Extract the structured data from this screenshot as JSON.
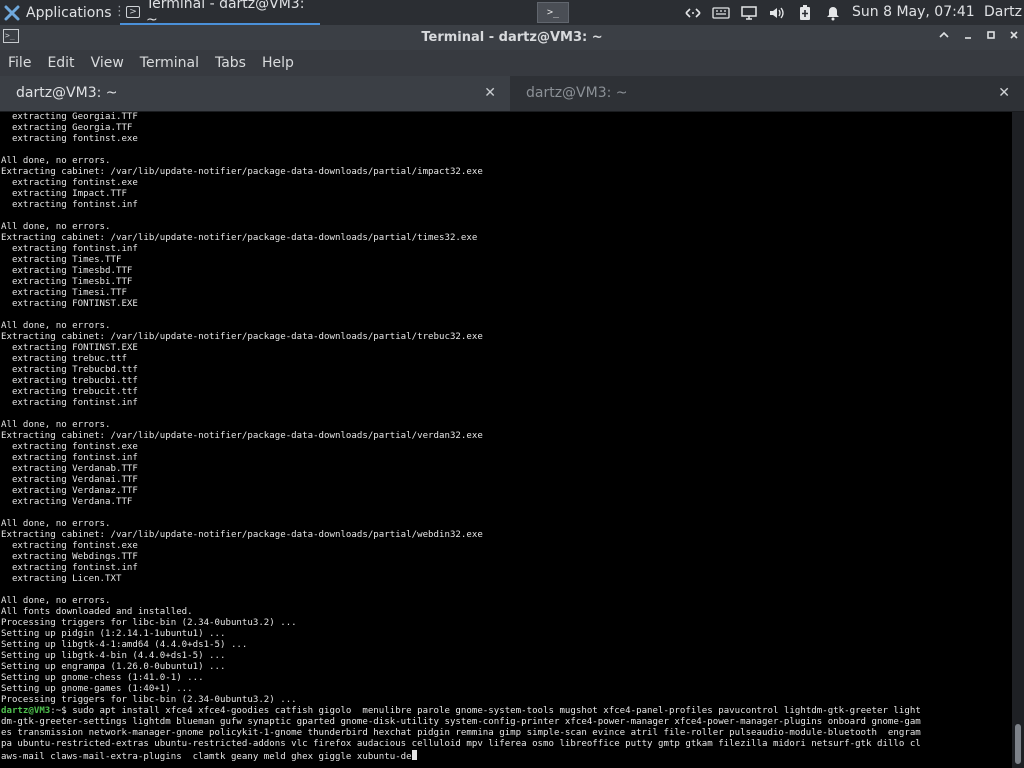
{
  "panel": {
    "applications_label": "Applications",
    "task_title": "Terminal - dartz@VM3: ~",
    "launcher_icon": ">_",
    "clock": "Sun  8 May, 07:41",
    "user": "Dartz",
    "tray_icons": [
      "network-icon",
      "keyboard-icon",
      "display-icon",
      "volume-icon",
      "battery-icon",
      "notification-bell-icon"
    ],
    "accent_color": "#4a90d9"
  },
  "window": {
    "title": "Terminal - dartz@VM3: ~",
    "buttons": {
      "maximize_up": "^",
      "minimize": "_",
      "restore": "□",
      "close": "×"
    }
  },
  "menu": [
    "File",
    "Edit",
    "View",
    "Terminal",
    "Tabs",
    "Help"
  ],
  "tabs": [
    {
      "label": "dartz@VM3: ~",
      "active": true
    },
    {
      "label": "dartz@VM3: ~",
      "active": false
    }
  ],
  "terminal": {
    "lines": [
      "  extracting Georgiai.TTF",
      "  extracting Georgia.TTF",
      "  extracting fontinst.exe",
      "",
      "All done, no errors.",
      "Extracting cabinet: /var/lib/update-notifier/package-data-downloads/partial/impact32.exe",
      "  extracting fontinst.exe",
      "  extracting Impact.TTF",
      "  extracting fontinst.inf",
      "",
      "All done, no errors.",
      "Extracting cabinet: /var/lib/update-notifier/package-data-downloads/partial/times32.exe",
      "  extracting fontinst.inf",
      "  extracting Times.TTF",
      "  extracting Timesbd.TTF",
      "  extracting Timesbi.TTF",
      "  extracting Timesi.TTF",
      "  extracting FONTINST.EXE",
      "",
      "All done, no errors.",
      "Extracting cabinet: /var/lib/update-notifier/package-data-downloads/partial/trebuc32.exe",
      "  extracting FONTINST.EXE",
      "  extracting trebuc.ttf",
      "  extracting Trebucbd.ttf",
      "  extracting trebucbi.ttf",
      "  extracting trebucit.ttf",
      "  extracting fontinst.inf",
      "",
      "All done, no errors.",
      "Extracting cabinet: /var/lib/update-notifier/package-data-downloads/partial/verdan32.exe",
      "  extracting fontinst.exe",
      "  extracting fontinst.inf",
      "  extracting Verdanab.TTF",
      "  extracting Verdanai.TTF",
      "  extracting Verdanaz.TTF",
      "  extracting Verdana.TTF",
      "",
      "All done, no errors.",
      "Extracting cabinet: /var/lib/update-notifier/package-data-downloads/partial/webdin32.exe",
      "  extracting fontinst.exe",
      "  extracting Webdings.TTF",
      "  extracting fontinst.inf",
      "  extracting Licen.TXT",
      "",
      "All done, no errors.",
      "All fonts downloaded and installed.",
      "Processing triggers for libc-bin (2.34-0ubuntu3.2) ...",
      "Setting up pidgin (1:2.14.1-1ubuntu1) ...",
      "Setting up libgtk-4-1:amd64 (4.4.0+ds1-5) ...",
      "Setting up libgtk-4-bin (4.4.0+ds1-5) ...",
      "Setting up engrampa (1.26.0-0ubuntu1) ...",
      "Setting up gnome-chess (1:41.0-1) ...",
      "Setting up gnome-games (1:40+1) ...",
      "Processing triggers for libc-bin (2.34-0ubuntu3.2) ..."
    ],
    "prompt_user": "dartz@VM3",
    "prompt_suffix": ":~$ ",
    "command_lines": [
      "sudo apt install xfce4 xfce4-goodies catfish gigolo  menulibre parole gnome-system-tools mugshot xfce4-panel-profiles pavucontrol lightdm-gtk-greeter light",
      "dm-gtk-greeter-settings lightdm blueman gufw synaptic gparted gnome-disk-utility system-config-printer xfce4-power-manager xfce4-power-manager-plugins onboard gnome-gam",
      "es transmission network-manager-gnome policykit-1-gnome thunderbird hexchat pidgin remmina gimp simple-scan evince atril file-roller pulseaudio-module-bluetooth  engram",
      "pa ubuntu-restricted-extras ubuntu-restricted-addons vlc firefox audacious celluloid mpv liferea osmo libreoffice putty gmtp gtkam filezilla midori netsurf-gtk dillo cl",
      "aws-mail claws-mail-extra-plugins  clamtk geany meld ghex giggle xubuntu-de"
    ]
  }
}
